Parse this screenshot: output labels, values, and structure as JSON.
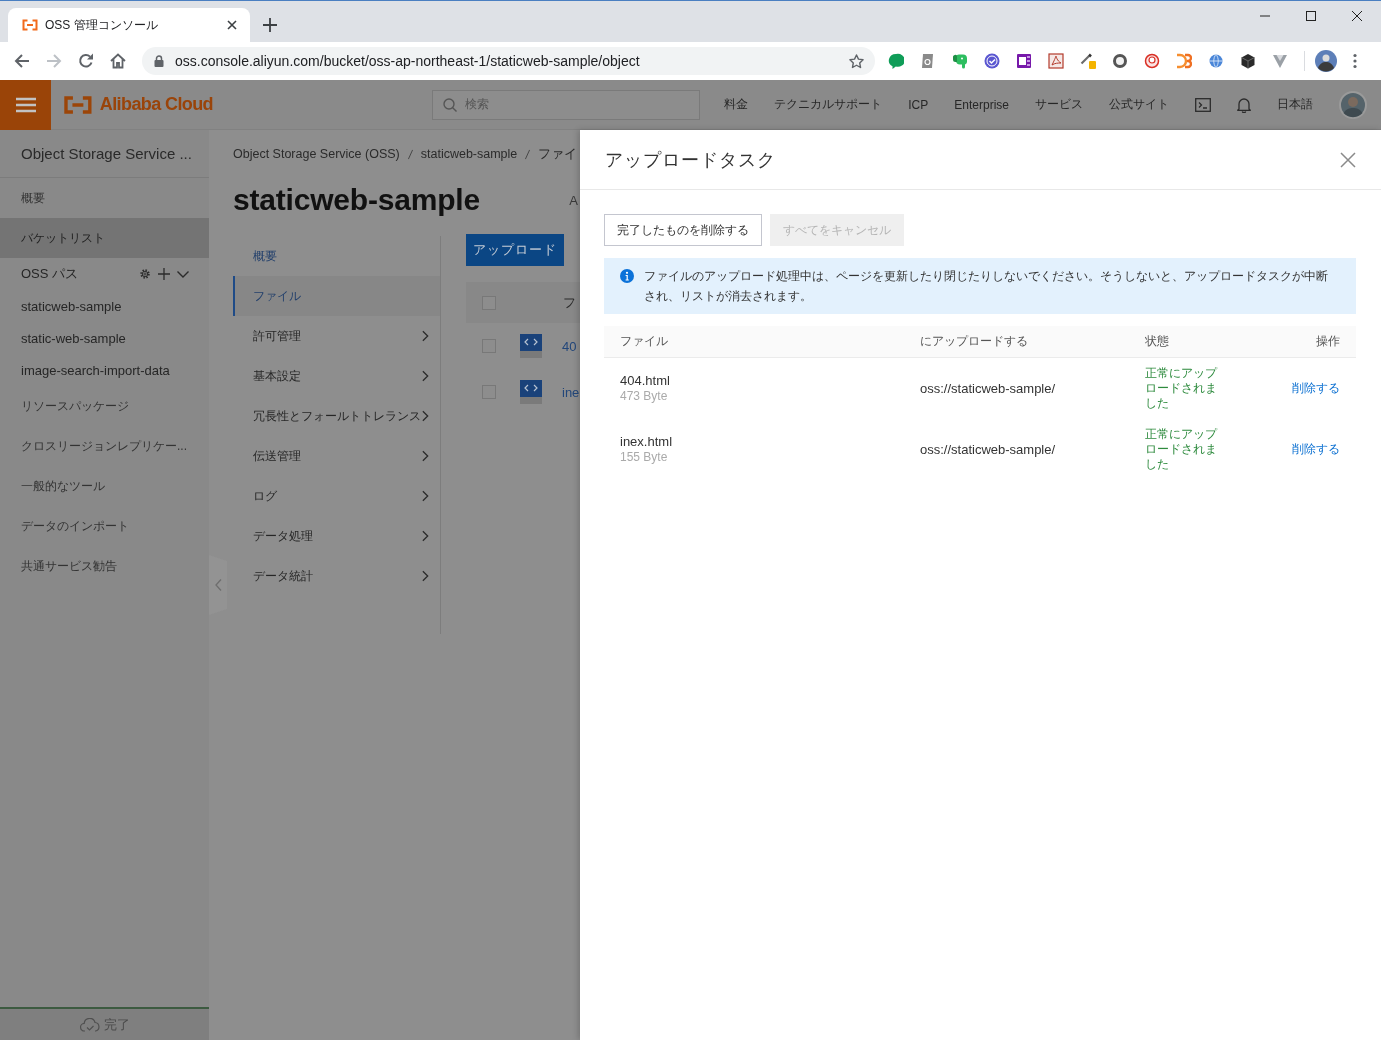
{
  "browser": {
    "tab_title": "OSS 管理コンソール",
    "url": "oss.console.aliyun.com/bucket/oss-ap-northeast-1/staticweb-sample/object"
  },
  "header": {
    "logo": "Alibaba Cloud",
    "search": {
      "placeholder": "検索"
    },
    "nav": [
      "料金",
      "テクニカルサポート",
      "ICP",
      "Enterprise",
      "サービス",
      "公式サイト"
    ],
    "language": "日本語"
  },
  "sidebar": {
    "title": "Object Storage Service ...",
    "items": [
      {
        "kind": "page",
        "label": "概要",
        "selected": false
      },
      {
        "kind": "page",
        "label": "バケットリスト",
        "selected": true
      },
      {
        "kind": "group",
        "label": "OSS パス",
        "expanded": true,
        "selected": false
      },
      {
        "kind": "bucket",
        "label": "staticweb-sample",
        "selected": false
      },
      {
        "kind": "bucket",
        "label": "static-web-sample",
        "selected": false
      },
      {
        "kind": "bucket",
        "label": "image-search-import-data",
        "selected": false
      },
      {
        "kind": "page",
        "label": "リソースパッケージ",
        "selected": false
      },
      {
        "kind": "page",
        "label": "クロスリージョンレプリケー...",
        "selected": false
      },
      {
        "kind": "page",
        "label": "一般的なツール",
        "selected": false
      },
      {
        "kind": "page",
        "label": "データのインポート",
        "selected": false
      },
      {
        "kind": "page",
        "label": "共通サービス勧告",
        "selected": false
      }
    ],
    "footer_status": "完了"
  },
  "bucket": {
    "breadcrumb": [
      "Object Storage Service (OSS)",
      "staticweb-sample",
      "ファイ"
    ],
    "title": "staticweb-sample",
    "side_text": "A",
    "menu": [
      {
        "kind": "link",
        "label": "概要",
        "selected": false
      },
      {
        "kind": "link",
        "label": "ファイル",
        "selected": true
      },
      {
        "kind": "submenu",
        "label": "許可管理",
        "selected": false
      },
      {
        "kind": "submenu",
        "label": "基本設定",
        "selected": false
      },
      {
        "kind": "submenu",
        "label": "冗長性とフォールトトレランス",
        "selected": false
      },
      {
        "kind": "submenu",
        "label": "伝送管理",
        "selected": false
      },
      {
        "kind": "submenu",
        "label": "ログ",
        "selected": false
      },
      {
        "kind": "submenu",
        "label": "データ処理",
        "selected": false
      },
      {
        "kind": "submenu",
        "label": "データ統計",
        "selected": false
      }
    ],
    "upload_button": "アップロード",
    "file_list": {
      "header_checked": false,
      "column_label": "フ",
      "rows": [
        {
          "checked": false,
          "name": "40"
        },
        {
          "checked": false,
          "name": "ine"
        }
      ]
    }
  },
  "upload_drawer": {
    "title": "アップロードタスク",
    "buttons": [
      {
        "label": "完了したものを削除する",
        "disabled": false
      },
      {
        "label": "すべてをキャンセル",
        "disabled": true
      }
    ],
    "notice": "ファイルのアップロード処理中は、ページを更新したり閉じたりしないでください。そうしないと、アップロードタスクが中断され、リストが消去されます。",
    "table": {
      "columns": [
        "ファイル",
        "にアップロードする",
        "状態",
        "操作"
      ],
      "rows": [
        {
          "file": "404.html",
          "size": "473 Byte",
          "destination": "oss://staticweb-sample/",
          "status": "正常にアップロードされました",
          "action": "削除する"
        },
        {
          "file": "inex.html",
          "size": "155 Byte",
          "destination": "oss://staticweb-sample/",
          "status": "正常にアップロードされました",
          "action": "削除する"
        }
      ]
    }
  }
}
